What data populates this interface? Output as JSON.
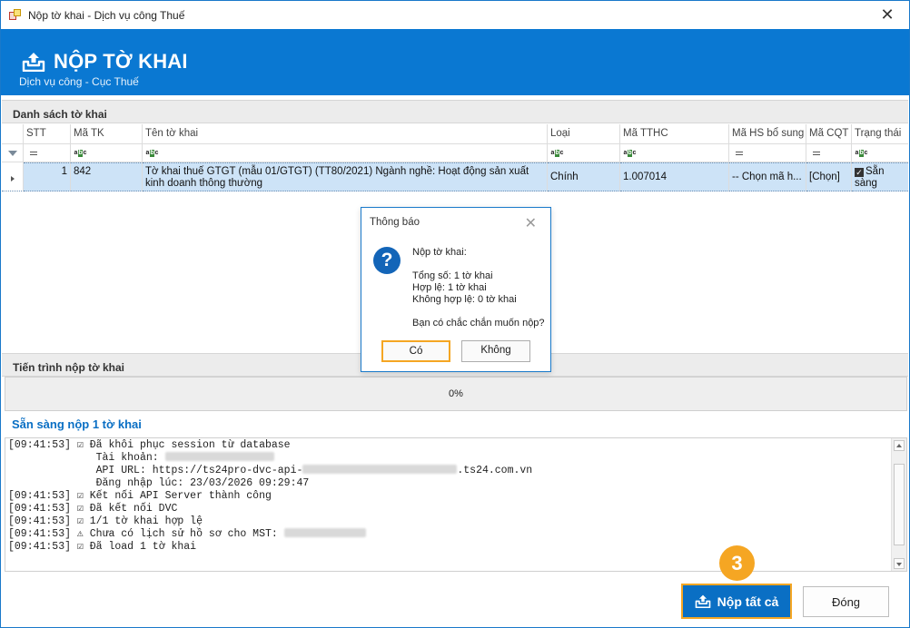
{
  "window": {
    "title": "Nộp tờ khai - Dịch vụ công Thuế",
    "close_glyph": "✕"
  },
  "banner": {
    "title": "NỘP TỜ KHAI",
    "subtitle": "Dịch vụ công - Cục Thuế",
    "icon": "upload-tray-icon"
  },
  "list_section": {
    "title": "Danh sách tờ khai"
  },
  "table": {
    "columns": [
      "STT",
      "Mã TK",
      "Tên tờ khai",
      "Loại",
      "Mã TTHC",
      "Mã HS bổ sung",
      "Mã CQT",
      "Trạng thái"
    ],
    "rows": [
      {
        "stt": "1",
        "ma_tk": "842",
        "ten": "Tờ khai thuế GTGT (mẫu 01/GTGT) (TT80/2021) Ngành nghề: Hoạt động sản xuất kinh doanh thông thường",
        "loai": "Chính",
        "ma_tthc": "1.007014",
        "ma_hs_bo_sung": "-- Chọn mã h...",
        "ma_cqt": "[Chọn]",
        "trang_thai": "Sẵn sàng"
      }
    ]
  },
  "progress_section": {
    "title": "Tiến trình nộp tờ khai",
    "percent_text": "0%",
    "percent": 0
  },
  "status": {
    "ready_text": "Sẵn sàng nộp 1 tờ khai"
  },
  "log": {
    "lines": [
      {
        "time": "[09:41:53]",
        "mark": "☑",
        "text": "Đã khôi phục session từ database"
      },
      {
        "time": "",
        "mark": "",
        "text": "  Tài khoản: ",
        "redacted": 120
      },
      {
        "time": "",
        "mark": "",
        "text": "  API URL: https://ts24pro-dvc-api-",
        "redacted": 170,
        "suffix": ".ts24.com.vn"
      },
      {
        "time": "",
        "mark": "",
        "text": "  Đăng nhập lúc: 23/03/2026 09:29:47"
      },
      {
        "time": "[09:41:53]",
        "mark": "☑",
        "text": "Kết nối API Server thành công"
      },
      {
        "time": "[09:41:53]",
        "mark": "☑",
        "text": "Đã kết nối DVC"
      },
      {
        "time": "[09:41:53]",
        "mark": "☑",
        "text": "1/1 tờ khai hợp lệ"
      },
      {
        "time": "[09:41:53]",
        "mark": "⚠",
        "text": "Chưa có lịch sử hồ sơ cho MST: ",
        "redacted": 90
      },
      {
        "time": "[09:41:53]",
        "mark": "☑",
        "text": "Đã load 1 tờ khai"
      }
    ]
  },
  "buttons": {
    "submit_all": "Nộp tất cả",
    "close": "Đóng",
    "step_number": "3"
  },
  "dialog": {
    "title": "Thông báo",
    "close_glyph": "✕",
    "icon": "question-icon",
    "heading": "Nộp tờ khai:",
    "total": "Tổng số: 1 tờ khai",
    "valid": "Hợp lệ: 1 tờ khai",
    "invalid": "Không hợp lệ: 0 tờ khai",
    "question": "Bạn có chắc chắn muốn nộp?",
    "yes": "Có",
    "no": "Không"
  },
  "colors": {
    "accent": "#0a78d2",
    "highlight": "#f5a623",
    "row_selected": "#cde3f7"
  }
}
